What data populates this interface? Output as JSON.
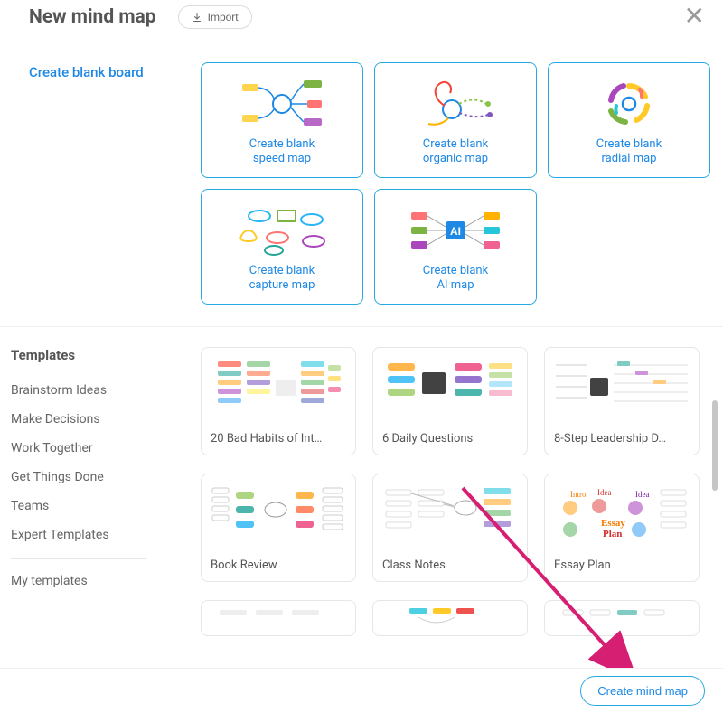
{
  "header": {
    "title": "New mind map",
    "import_label": "Import"
  },
  "sidebar": {
    "create_blank": "Create blank board",
    "templates_heading": "Templates",
    "categories": [
      "Brainstorm Ideas",
      "Make Decisions",
      "Work Together",
      "Get Things Done",
      "Teams",
      "Expert Templates"
    ],
    "my_templates": "My templates"
  },
  "blank_cards": [
    {
      "label": "Create blank\nspeed map"
    },
    {
      "label": "Create blank\norganic map"
    },
    {
      "label": "Create blank\nradial map"
    },
    {
      "label": "Create blank\ncapture map"
    },
    {
      "label": "Create blank\nAI map"
    }
  ],
  "templates": [
    {
      "label": "20 Bad Habits of Int…"
    },
    {
      "label": "6 Daily Questions"
    },
    {
      "label": "8-Step Leadership D…"
    },
    {
      "label": "Book Review"
    },
    {
      "label": "Class Notes"
    },
    {
      "label": "Essay Plan"
    }
  ],
  "footer": {
    "create_label": "Create mind map"
  },
  "colors": {
    "accent": "#1e88e5",
    "card_border": "#29a9e3",
    "annotation": "#d61f72"
  }
}
